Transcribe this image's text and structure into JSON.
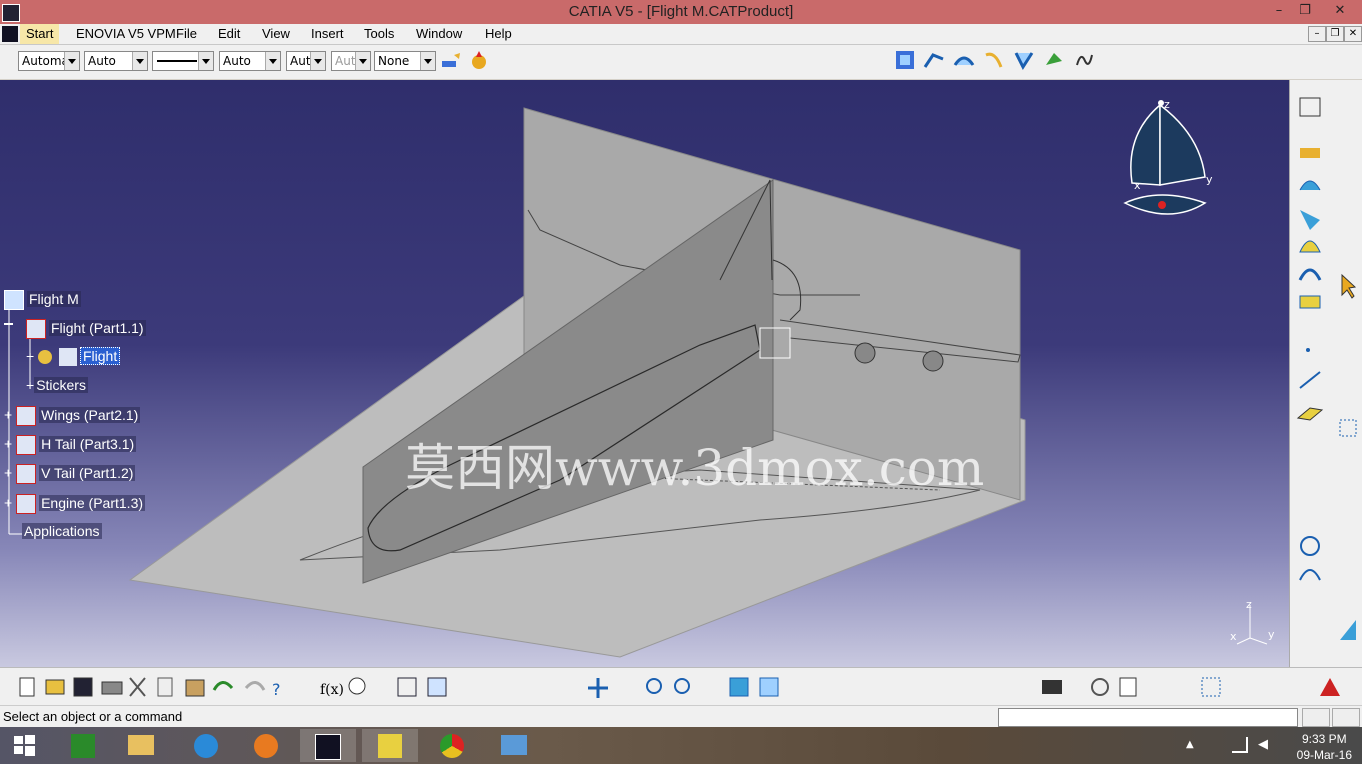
{
  "window": {
    "title": "CATIA V5 - [Flight M.CATProduct]",
    "minimize": "–",
    "maximize": "❐",
    "close": "✕"
  },
  "menubar": {
    "items": [
      "Start",
      "ENOVIA V5 VPM",
      "File",
      "Edit",
      "View",
      "Insert",
      "Tools",
      "Window",
      "Help"
    ]
  },
  "properties_toolbar": {
    "color": "Automa",
    "transparency": "Auto",
    "linetype": "",
    "thickness": "Auto",
    "point_symbol": "Aut",
    "render_style": "Aut",
    "layer": "None"
  },
  "tree": {
    "nodes": [
      {
        "label": "Flight M"
      },
      {
        "label": "Flight (Part1.1)"
      },
      {
        "label": "Flight"
      },
      {
        "label": "Stickers"
      },
      {
        "label": "Wings (Part2.1)"
      },
      {
        "label": "H Tail (Part3.1)"
      },
      {
        "label": "V Tail (Part1.2)"
      },
      {
        "label": "Engine (Part1.3)"
      },
      {
        "label": "Applications"
      }
    ]
  },
  "watermark": "莫西网www.3dmox.com",
  "compass": {
    "z": "z",
    "x": "x",
    "y": "y"
  },
  "axis": {
    "z": "z",
    "x": "x",
    "y": "y"
  },
  "status": {
    "message": "Select an object or a command"
  },
  "taskbar": {
    "time": "9:33 PM",
    "date": "09-Mar-16"
  },
  "colors": {
    "titlebar": "#c96a6a",
    "viewport_top": "#2f2e6c",
    "viewport_bottom": "#c9c9e0",
    "selection": "#2a5fd0"
  }
}
